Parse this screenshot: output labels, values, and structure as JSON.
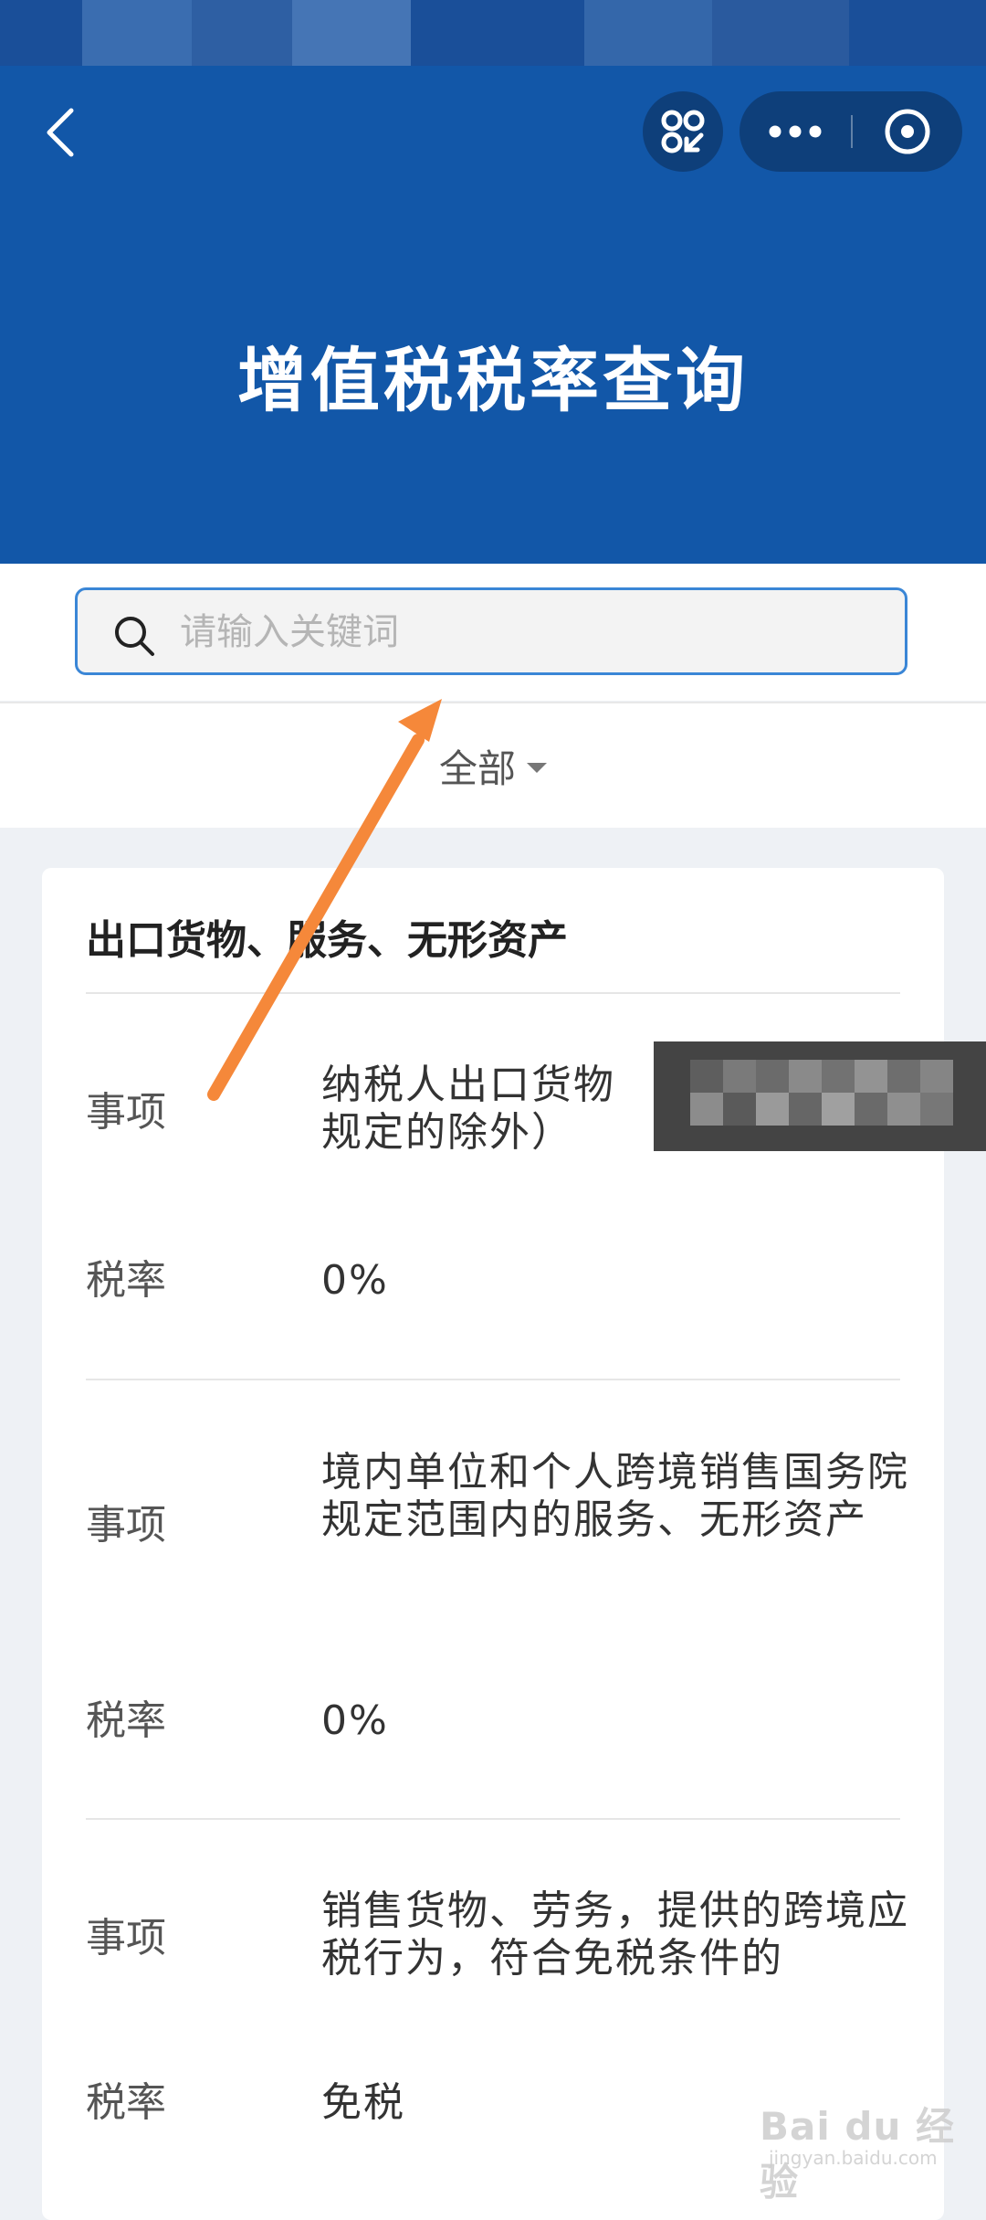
{
  "header": {
    "title": "增值税税率查询",
    "back_icon": "chevron-left-icon",
    "scan_icon": "scan-icon",
    "more_icon": "more-dots-icon",
    "close_icon": "miniapp-close-icon",
    "bg_color": "#1257a8"
  },
  "search": {
    "placeholder": "请输入关键词",
    "value": "",
    "icon": "search-icon"
  },
  "filter": {
    "label": "全部",
    "icon": "caret-down-icon"
  },
  "card": {
    "title": "出口货物、服务、无形资产",
    "items": [
      {
        "item_label": "事项",
        "item_value": "纳税人出口货物",
        "item_value_line2": "规定的除外）",
        "rate_label": "税率",
        "rate_value": "0%"
      },
      {
        "item_label": "事项",
        "item_value": "境内单位和个人跨境销售国务院规定范围内的服务、无形资产",
        "rate_label": "税率",
        "rate_value": "0%"
      },
      {
        "item_label": "事项",
        "item_value": "销售货物、劳务，提供的跨境应税行为，符合免税条件的",
        "rate_label": "税率",
        "rate_value": "免税"
      }
    ]
  },
  "annotation": {
    "arrow_color": "#f5883a"
  },
  "watermark": {
    "text": "Bai du 经验",
    "subtext": "jingyan.baidu.com"
  }
}
